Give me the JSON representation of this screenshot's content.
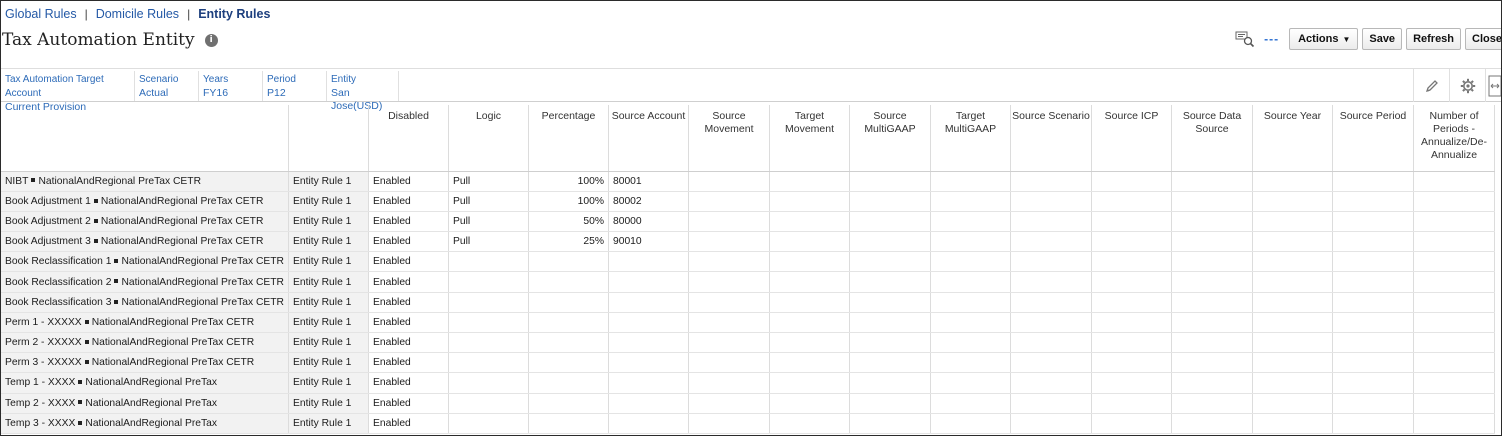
{
  "breadcrumb": {
    "global": "Global Rules",
    "domicile": "Domicile Rules",
    "entity": "Entity Rules",
    "separator": "|"
  },
  "page": {
    "title": "Tax Automation Entity",
    "info_glyph": "i"
  },
  "toolbar": {
    "dashes": "---",
    "actions": "Actions",
    "save": "Save",
    "refresh": "Refresh",
    "close": "Close"
  },
  "pov": [
    {
      "label": "Tax Automation Target Account",
      "value": "Current Provision"
    },
    {
      "label": "Scenario",
      "value": "Actual"
    },
    {
      "label": "Years",
      "value": "FY16"
    },
    {
      "label": "Period",
      "value": "P12"
    },
    {
      "label": "Entity",
      "value": "San Jose(USD)"
    }
  ],
  "grid": {
    "columns": [
      "Disabled",
      "Logic",
      "Percentage",
      "Source Account",
      "Source Movement",
      "Target Movement",
      "Source MultiGAAP",
      "Target MultiGAAP",
      "Source Scenario",
      "Source ICP",
      "Source Data Source",
      "Source Year",
      "Source Period",
      "Number of Periods - Annualize/De-Annualize"
    ],
    "rows": [
      {
        "account": "NIBT",
        "member": "NationalAndRegional PreTax CETR",
        "rule": "Entity Rule 1",
        "disabled": "Enabled",
        "logic": "Pull",
        "percentage": "100%",
        "source_account": "80001"
      },
      {
        "account": "Book Adjustment 1",
        "member": "NationalAndRegional PreTax CETR",
        "rule": "Entity Rule 1",
        "disabled": "Enabled",
        "logic": "Pull",
        "percentage": "100%",
        "source_account": "80002"
      },
      {
        "account": "Book Adjustment 2",
        "member": "NationalAndRegional PreTax CETR",
        "rule": "Entity Rule 1",
        "disabled": "Enabled",
        "logic": "Pull",
        "percentage": "50%",
        "source_account": "80000"
      },
      {
        "account": "Book Adjustment 3",
        "member": "NationalAndRegional PreTax CETR",
        "rule": "Entity Rule 1",
        "disabled": "Enabled",
        "logic": "Pull",
        "percentage": "25%",
        "source_account": "90010"
      },
      {
        "account": "Book Reclassification 1",
        "member": "NationalAndRegional PreTax CETR",
        "rule": "Entity Rule 1",
        "disabled": "Enabled",
        "logic": "",
        "percentage": "",
        "source_account": ""
      },
      {
        "account": "Book Reclassification 2",
        "member": "NationalAndRegional PreTax CETR",
        "rule": "Entity Rule 1",
        "disabled": "Enabled",
        "logic": "",
        "percentage": "",
        "source_account": ""
      },
      {
        "account": "Book Reclassification 3",
        "member": "NationalAndRegional PreTax CETR",
        "rule": "Entity Rule 1",
        "disabled": "Enabled",
        "logic": "",
        "percentage": "",
        "source_account": ""
      },
      {
        "account": "Perm 1 - XXXXX",
        "member": "NationalAndRegional PreTax CETR",
        "rule": "Entity Rule 1",
        "disabled": "Enabled",
        "logic": "",
        "percentage": "",
        "source_account": ""
      },
      {
        "account": "Perm 2 - XXXXX",
        "member": "NationalAndRegional PreTax CETR",
        "rule": "Entity Rule 1",
        "disabled": "Enabled",
        "logic": "",
        "percentage": "",
        "source_account": ""
      },
      {
        "account": "Perm 3 - XXXXX",
        "member": "NationalAndRegional PreTax CETR",
        "rule": "Entity Rule 1",
        "disabled": "Enabled",
        "logic": "",
        "percentage": "",
        "source_account": ""
      },
      {
        "account": "Temp 1 - XXXX",
        "member": "NationalAndRegional PreTax",
        "rule": "Entity Rule 1",
        "disabled": "Enabled",
        "logic": "",
        "percentage": "",
        "source_account": ""
      },
      {
        "account": "Temp 2 - XXXX",
        "member": "NationalAndRegional PreTax",
        "rule": "Entity Rule 1",
        "disabled": "Enabled",
        "logic": "",
        "percentage": "",
        "source_account": ""
      },
      {
        "account": "Temp 3 - XXXX",
        "member": "NationalAndRegional PreTax",
        "rule": "Entity Rule 1",
        "disabled": "Enabled",
        "logic": "",
        "percentage": "",
        "source_account": ""
      }
    ]
  },
  "icons": {
    "search_options": "search-options-icon",
    "edit": "pencil-icon",
    "settings": "gear-icon",
    "collapse": "collapse-icon"
  },
  "colors": {
    "link": "#2459a6",
    "pov_text": "#2d6bb8",
    "row_header_bg": "#f2f2f2"
  }
}
